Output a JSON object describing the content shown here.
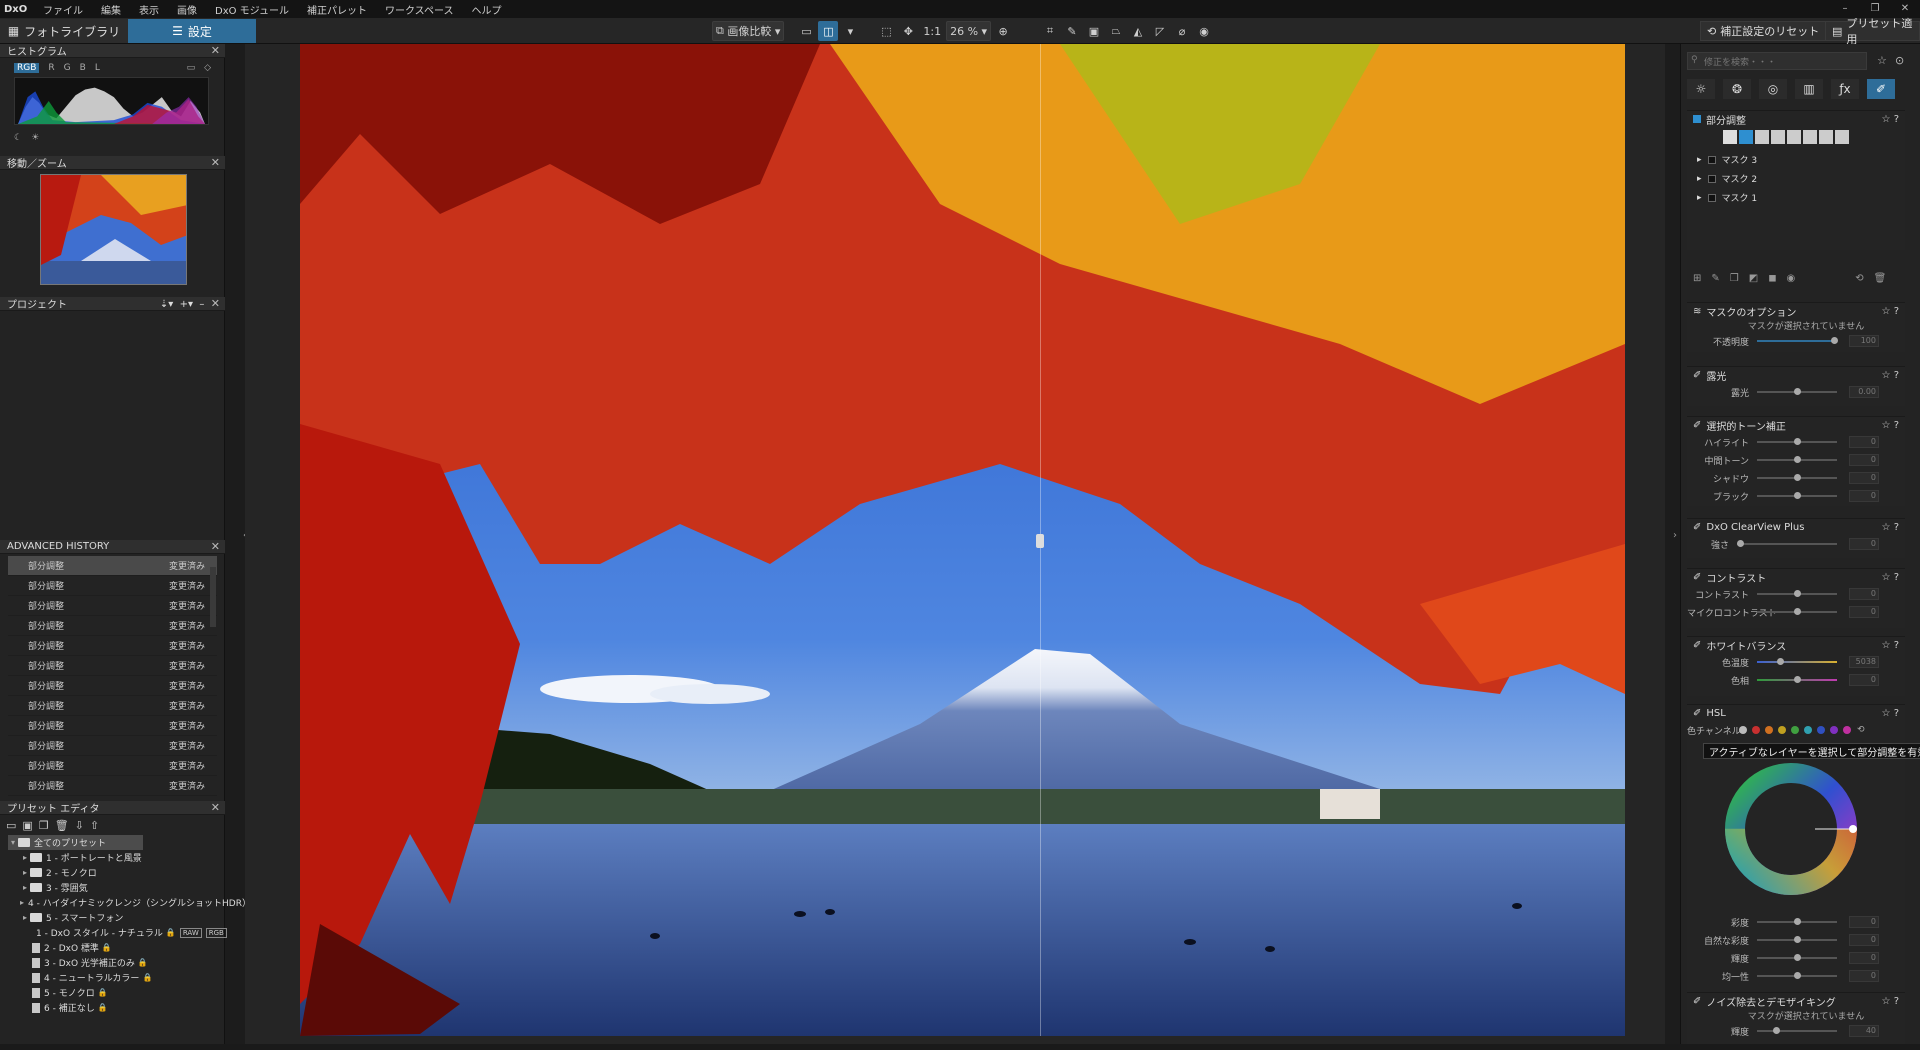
{
  "menu": {
    "logo": "DxO",
    "items": [
      "ファイル",
      "編集",
      "表示",
      "画像",
      "DxO モジュール",
      "補正パレット",
      "ワークスペース",
      "ヘルプ"
    ]
  },
  "window_controls": [
    "–",
    "❐",
    "✕"
  ],
  "tabs": {
    "library": "フォトライブラリ",
    "settings": "設定"
  },
  "toolbar": {
    "compare": "画像比較",
    "zoom_1to1": "1:1",
    "zoom_level": "26 %",
    "reset": "補正設定のリセット",
    "apply_preset": "プリセット適用"
  },
  "left": {
    "histogram": {
      "title": "ヒストグラム",
      "channels": [
        "RGB",
        "R",
        "G",
        "B",
        "L"
      ]
    },
    "navigator": {
      "title": "移動／ズーム"
    },
    "project": {
      "title": "プロジェクト"
    },
    "history": {
      "title": "ADVANCED HISTORY",
      "rows": [
        {
          "name": "部分調整",
          "status": "変更済み"
        },
        {
          "name": "部分調整",
          "status": "変更済み"
        },
        {
          "name": "部分調整",
          "status": "変更済み"
        },
        {
          "name": "部分調整",
          "status": "変更済み"
        },
        {
          "name": "部分調整",
          "status": "変更済み"
        },
        {
          "name": "部分調整",
          "status": "変更済み"
        },
        {
          "name": "部分調整",
          "status": "変更済み"
        },
        {
          "name": "部分調整",
          "status": "変更済み"
        },
        {
          "name": "部分調整",
          "status": "変更済み"
        },
        {
          "name": "部分調整",
          "status": "変更済み"
        },
        {
          "name": "部分調整",
          "status": "変更済み"
        },
        {
          "name": "部分調整",
          "status": "変更済み"
        }
      ]
    },
    "preset_editor": {
      "title": "プリセット エディタ",
      "root": "全てのプリセット",
      "folders": [
        "1 - ポートレートと風景",
        "2 - モノクロ",
        "3 - 雰囲気",
        "4 - ハイダイナミックレンジ（シングルショットHDR）",
        "5 - スマートフォン"
      ],
      "presets": [
        {
          "name": "1 - DxO スタイル - ナチュラル",
          "badges": [
            "RAW",
            "RGB"
          ]
        },
        {
          "name": "2 - DxO 標準",
          "badges": []
        },
        {
          "name": "3 - DxO 光学補正のみ",
          "badges": []
        },
        {
          "name": "4 - ニュートラルカラー",
          "badges": []
        },
        {
          "name": "5 - モノクロ",
          "badges": []
        },
        {
          "name": "6 - 補正なし",
          "badges": []
        }
      ]
    }
  },
  "right": {
    "search_placeholder": "修正を検索・・・",
    "local_adj": {
      "title": "部分調整",
      "masks": [
        "マスク 3",
        "マスク 2",
        "マスク 1"
      ]
    },
    "mask_options": {
      "title": "マスクのオプション",
      "note": "マスクが選択されていません",
      "opacity_label": "不透明度",
      "opacity_value": "100"
    },
    "exposure": {
      "title": "露光",
      "label": "露光",
      "value": "0.00"
    },
    "tone": {
      "title": "選択的トーン補正",
      "rows": [
        {
          "label": "ハイライト",
          "value": "0"
        },
        {
          "label": "中間トーン",
          "value": "0"
        },
        {
          "label": "シャドウ",
          "value": "0"
        },
        {
          "label": "ブラック",
          "value": "0"
        }
      ]
    },
    "clearview": {
      "title": "DxO ClearView Plus",
      "label": "強さ",
      "value": "0"
    },
    "contrast": {
      "title": "コントラスト",
      "rows": [
        {
          "label": "コントラスト",
          "value": "0"
        },
        {
          "label": "マイクロコントラスト",
          "value": "0"
        }
      ]
    },
    "wb": {
      "title": "ホワイトバランス",
      "rows": [
        {
          "label": "色温度",
          "value": "5038"
        },
        {
          "label": "色相",
          "value": "0"
        }
      ]
    },
    "hsl": {
      "title": "HSL",
      "channel_label": "色チャンネル",
      "rows": [
        {
          "label": "彩度",
          "value": "0"
        },
        {
          "label": "自然な彩度",
          "value": "0"
        },
        {
          "label": "輝度",
          "value": "0"
        },
        {
          "label": "均一性",
          "value": "0"
        }
      ]
    },
    "noise": {
      "title": "ノイズ除去とデモザイキング",
      "note": "マスクが選択されていません",
      "label": "輝度",
      "value": "40"
    },
    "tooltip": "アクティブなレイヤーを選択して部分調整を有効にします"
  }
}
